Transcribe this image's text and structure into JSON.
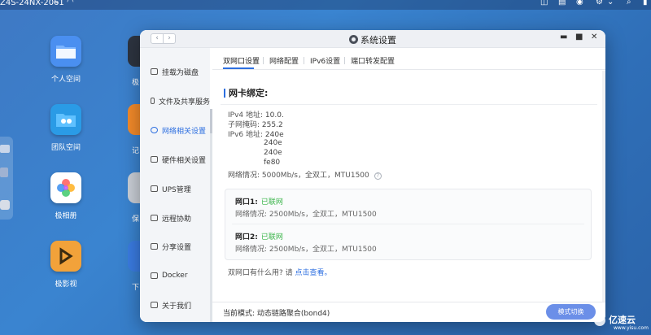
{
  "desktop": {
    "device_name": "Z4S-24NX-2061",
    "apps": [
      {
        "label": "个人空间",
        "color": "#4a8ff0"
      },
      {
        "label": "团队空间",
        "color": "#2a9be6"
      },
      {
        "label": "极相册",
        "color": "#ffffff"
      },
      {
        "label": "极影视",
        "color": "#f2a23a"
      }
    ],
    "partial_apps": [
      {
        "label": "极",
        "color": "#2d3440"
      },
      {
        "label": "记",
        "color": "#f28a2a"
      },
      {
        "label": "保",
        "color": "#c9ced6"
      },
      {
        "label": "下",
        "color": "#3a7be0"
      }
    ]
  },
  "window": {
    "title": "系统设置",
    "nav_back": "‹",
    "nav_forward": "›",
    "controls": {
      "minimize": "▬",
      "maximize": "■",
      "close": "✕"
    }
  },
  "sidebar": {
    "items": [
      {
        "label": "挂载为磁盘",
        "icon": "disk-icon"
      },
      {
        "label": "文件及共享服务",
        "icon": "folder-icon"
      },
      {
        "label": "网络相关设置",
        "icon": "network-icon",
        "active": true
      },
      {
        "label": "硬件相关设置",
        "icon": "hardware-icon"
      },
      {
        "label": "UPS管理",
        "icon": "battery-icon"
      },
      {
        "label": "远程协助",
        "icon": "remote-icon"
      },
      {
        "label": "分享设置",
        "icon": "share-icon"
      },
      {
        "label": "Docker",
        "icon": "docker-icon"
      },
      {
        "label": "关于我们",
        "icon": "info-icon"
      }
    ]
  },
  "tabs": [
    {
      "label": "双网口设置",
      "active": true
    },
    {
      "label": "网络配置"
    },
    {
      "label": "IPv6设置"
    },
    {
      "label": "端口转发配置"
    }
  ],
  "nic_binding": {
    "title": "网卡绑定:",
    "ipv4_label": "IPv4 地址:",
    "ipv4_value": "10.0.",
    "mask_label": "子网掩码:",
    "mask_value": "255.2",
    "ipv6_label": "IPv6 地址:",
    "ipv6_values": [
      "240e",
      "240e",
      "240e",
      "fe80"
    ],
    "net_status": "网络情况: 5000Mb/s，全双工，MTU1500",
    "help": "?"
  },
  "ports": [
    {
      "name": "网口1:",
      "status": "已联网",
      "info": "网络情况: 2500Mb/s，全双工，MTU1500"
    },
    {
      "name": "网口2:",
      "status": "已联网",
      "info": "网络情况: 2500Mb/s，全双工，MTU1500"
    }
  ],
  "hint": {
    "text": "双网口有什么用? 请",
    "link": "点击查看。"
  },
  "footer": {
    "current_mode": "当前模式: 动态链路聚合(bond4)",
    "switch_button": "模式切换"
  },
  "watermark": {
    "text": "亿速云",
    "sub": "www.yisu.com"
  },
  "colors": {
    "accent": "#2d6fe0",
    "online": "#3bb54a",
    "button": "#6b8fe8"
  }
}
